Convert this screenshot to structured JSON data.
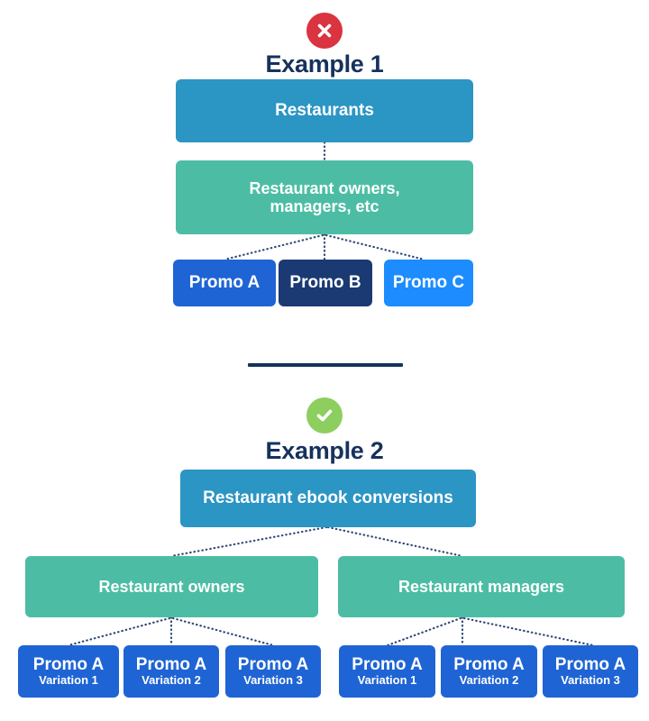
{
  "examples": [
    {
      "id": "example-1",
      "status_icon": "error-x-icon",
      "status_color": "#d9343f",
      "status_meaning": "incorrect",
      "title": "Example 1",
      "root": {
        "label": "Restaurants",
        "color": "#2b95c4"
      },
      "mid": [
        {
          "label_line1": "Restaurant owners,",
          "label_line2": "managers, etc",
          "color": "#4cbda4"
        }
      ],
      "leaves": [
        {
          "label": "Promo A",
          "color": "#1f64d4"
        },
        {
          "label": "Promo B",
          "color": "#1b3a73"
        },
        {
          "label": "Promo C",
          "color": "#1d8cff"
        }
      ]
    },
    {
      "id": "example-2",
      "status_icon": "success-check-icon",
      "status_color": "#8ccf5e",
      "status_meaning": "correct",
      "title": "Example 2",
      "root": {
        "label": "Restaurant ebook conversions",
        "color": "#2b95c4"
      },
      "mid": [
        {
          "label": "Restaurant owners",
          "color": "#4cbda4"
        },
        {
          "label": "Restaurant managers",
          "color": "#4cbda4"
        }
      ],
      "leaves_left": [
        {
          "line1": "Promo A",
          "line2": "Variation 1",
          "color": "#1f64d4"
        },
        {
          "line1": "Promo A",
          "line2": "Variation 2",
          "color": "#1f64d4"
        },
        {
          "line1": "Promo A",
          "line2": "Variation 3",
          "color": "#1f64d4"
        }
      ],
      "leaves_right": [
        {
          "line1": "Promo A",
          "line2": "Variation 1",
          "color": "#1f64d4"
        },
        {
          "line1": "Promo A",
          "line2": "Variation 2",
          "color": "#1f64d4"
        },
        {
          "line1": "Promo A",
          "line2": "Variation 3",
          "color": "#1f64d4"
        }
      ]
    }
  ],
  "divider": {
    "color": "#16325c"
  },
  "heading_color": "#16325c",
  "connector_color": "#2f4b75"
}
